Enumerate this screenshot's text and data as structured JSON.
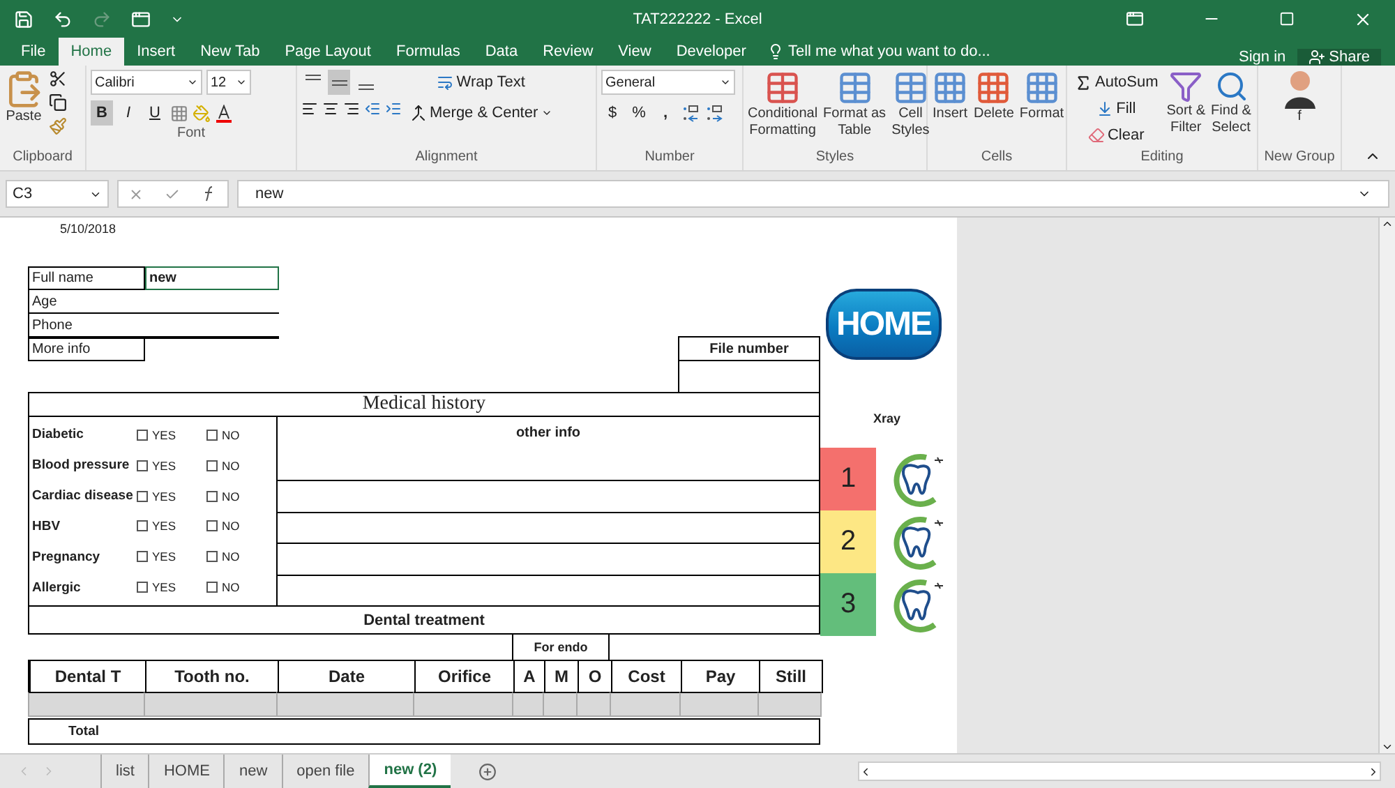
{
  "title_bar": {
    "title": "TAT222222 - Excel"
  },
  "menu_tabs": [
    {
      "label": "File",
      "selected": false
    },
    {
      "label": "Home",
      "selected": true
    },
    {
      "label": "Insert",
      "selected": false
    },
    {
      "label": "New Tab",
      "selected": false
    },
    {
      "label": "Page Layout",
      "selected": false
    },
    {
      "label": "Formulas",
      "selected": false
    },
    {
      "label": "Data",
      "selected": false
    },
    {
      "label": "Review",
      "selected": false
    },
    {
      "label": "View",
      "selected": false
    },
    {
      "label": "Developer",
      "selected": false
    }
  ],
  "tell_me": "Tell me what you want to do...",
  "account": {
    "sign_in": "Sign in",
    "share": "Share"
  },
  "ribbon": {
    "clipboard": {
      "paste": "Paste",
      "label": "Clipboard"
    },
    "font": {
      "name": "Calibri",
      "size": "12",
      "styles": [
        {
          "label": "B",
          "selected": true
        },
        {
          "label": "I",
          "selected": false
        },
        {
          "label": "U",
          "selected": false
        }
      ],
      "label": "Font"
    },
    "alignment": {
      "vertical": [
        {
          "selected": false
        },
        {
          "selected": true
        },
        {
          "selected": false
        }
      ],
      "wrap": "Wrap Text",
      "merge": "Merge & Center",
      "label": "Alignment"
    },
    "number": {
      "format": "General",
      "currency": "$",
      "percent": "%",
      "comma": ",",
      "label": "Number"
    },
    "styles": {
      "items": [
        {
          "line1": "Conditional",
          "line2": "Formatting"
        },
        {
          "line1": "Format as",
          "line2": "Table"
        },
        {
          "line1": "Cell",
          "line2": "Styles"
        }
      ],
      "label": "Styles"
    },
    "cells": {
      "items": [
        "Insert",
        "Delete",
        "Format"
      ],
      "label": "Cells"
    },
    "editing": {
      "autosum": "AutoSum",
      "fill": "Fill",
      "clear": "Clear",
      "sort": {
        "line1": "Sort &",
        "line2": "Filter"
      },
      "find": {
        "line1": "Find &",
        "line2": "Select"
      },
      "label": "Editing"
    },
    "new_group": {
      "button": "f",
      "label": "New Group"
    }
  },
  "formula_bar": {
    "name_box": "C3",
    "value": "new"
  },
  "sheet": {
    "date": "5/10/2018",
    "patient_fields": [
      {
        "label": "Full name",
        "value": "new"
      },
      {
        "label": "Age"
      },
      {
        "label": "Phone"
      },
      {
        "label": "More info"
      }
    ],
    "file_number": "File number",
    "medical_history": "Medical history",
    "other_info": "other info",
    "conditions": [
      {
        "name": "Diabetic",
        "yes": "YES",
        "no": "NO",
        "yes_checked": false,
        "no_checked": false
      },
      {
        "name": "Blood pressure",
        "yes": "YES",
        "no": "NO",
        "yes_checked": false,
        "no_checked": false
      },
      {
        "name": "Cardiac disease",
        "yes": "YES",
        "no": "NO",
        "yes_checked": false,
        "no_checked": false
      },
      {
        "name": "HBV",
        "yes": "YES",
        "no": "NO",
        "yes_checked": false,
        "no_checked": false
      },
      {
        "name": "Pregnancy",
        "yes": "YES",
        "no": "NO",
        "yes_checked": false,
        "no_checked": false
      },
      {
        "name": "Allergic",
        "yes": "YES",
        "no": "NO",
        "yes_checked": false,
        "no_checked": false
      }
    ],
    "dental_treatment": "Dental treatment",
    "for_endo": "For endo",
    "columns": [
      "Dental T",
      "Tooth no.",
      "Date",
      "Orifice",
      "A",
      "M",
      "O",
      "Cost",
      "Pay",
      "Still"
    ],
    "total": "Total",
    "home_button": "HOME",
    "xray": "Xray",
    "xray_items": [
      {
        "number": "1",
        "color": "#f4706d"
      },
      {
        "number": "2",
        "color": "#fde784"
      },
      {
        "number": "3",
        "color": "#63be7b"
      }
    ]
  },
  "sheet_tabs": [
    {
      "label": "list",
      "selected": false
    },
    {
      "label": "HOME",
      "selected": false
    },
    {
      "label": "new",
      "selected": false
    },
    {
      "label": "open file",
      "selected": false
    },
    {
      "label": "new (2)",
      "selected": true
    }
  ]
}
